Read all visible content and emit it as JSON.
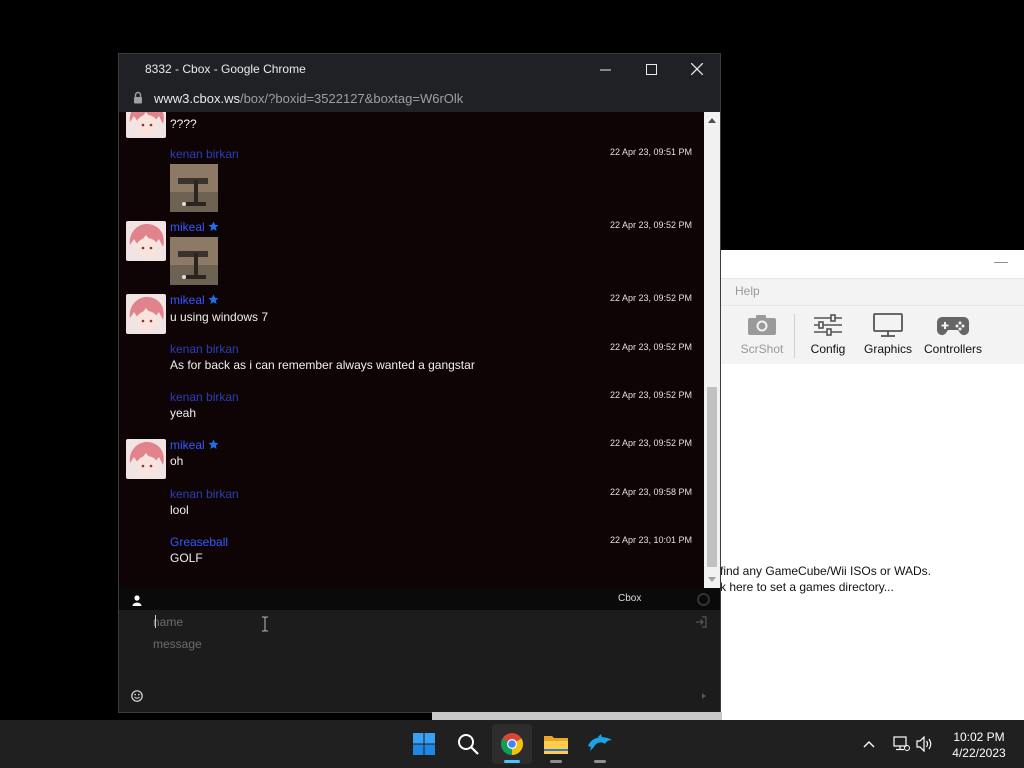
{
  "dolphin": {
    "menu": [
      "Help"
    ],
    "toolbar": [
      {
        "label": "ScrShot",
        "icon": "camera-icon",
        "enabled": false
      },
      {
        "label": "Config",
        "icon": "sliders-icon",
        "enabled": true
      },
      {
        "label": "Graphics",
        "icon": "monitor-icon",
        "enabled": true
      },
      {
        "label": "Controllers",
        "icon": "gamepad-icon",
        "enabled": true
      }
    ],
    "empty_line1": "find any GameCube/Wii ISOs or WADs.",
    "empty_line2": "k here to set a games directory..."
  },
  "chrome": {
    "title": "8332 - Cbox - Google Chrome",
    "url_host": "www3.cbox.ws",
    "url_path": "/box/?boxid=3522127&boxtag=W6rOlk"
  },
  "chat": {
    "messages": [
      {
        "user": "",
        "time": "",
        "text": "????",
        "avatar": true
      },
      {
        "user": "kenan birkan",
        "time": "22 Apr 23, 09:51 PM",
        "text": "",
        "image": true
      },
      {
        "user": "mikeal",
        "time": "22 Apr 23, 09:52 PM",
        "text": "",
        "image": true,
        "avatar": true,
        "star": true
      },
      {
        "user": "mikeal",
        "time": "22 Apr 23, 09:52 PM",
        "text": "u using windows 7",
        "avatar": true,
        "star": true
      },
      {
        "user": "kenan birkan",
        "time": "22 Apr 23, 09:52 PM",
        "text": "As for back as i can remember always wanted a gangstar"
      },
      {
        "user": "kenan birkan",
        "time": "22 Apr 23, 09:52 PM",
        "text": "yeah"
      },
      {
        "user": "mikeal",
        "time": "22 Apr 23, 09:52 PM",
        "text": "oh",
        "avatar": true,
        "star": true
      },
      {
        "user": "kenan birkan",
        "time": "22 Apr 23, 09:58 PM",
        "text": "lool"
      },
      {
        "user": "Greaseball",
        "time": "22 Apr 23, 10:01 PM",
        "text": "GOLF"
      }
    ],
    "footer_brand": "Cbox",
    "name_placeholder": "name",
    "message_placeholder": "message"
  },
  "taskbar": {
    "apps": [
      "start-icon",
      "search-icon",
      "chrome-icon",
      "file-explorer-icon",
      "dolphin-icon"
    ],
    "time": "10:02 PM",
    "date": "4/22/2023"
  }
}
